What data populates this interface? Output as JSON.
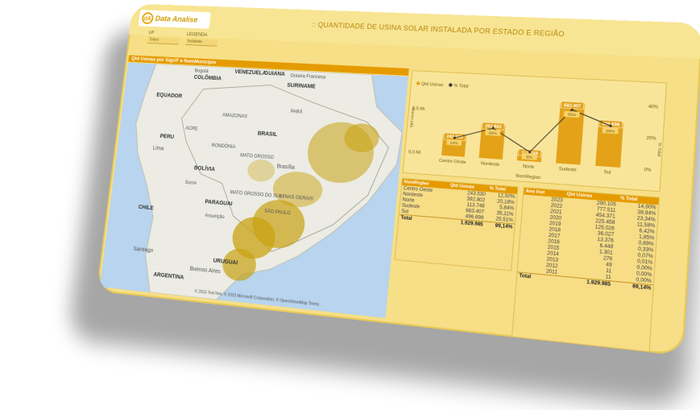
{
  "header": {
    "logo_mark": "dA",
    "logo_text": "Data Analise",
    "title": ":: QUANTIDADE DE USINA SOLAR INSTALADA POR ESTADO E REGIÃO"
  },
  "filters": [
    {
      "label": "UF",
      "value": "Todos"
    },
    {
      "label": "LEGENDA",
      "value": "Instalada"
    }
  ],
  "map": {
    "title": "Qtd Usinas por SigUF e NomMunicipio",
    "countries": [
      "BRASIL",
      "BOLÍVIA",
      "PARAGUAI",
      "CHILE",
      "ARGENTINA",
      "URUGUAI",
      "PERU",
      "COLÔMBIA",
      "EQUADOR",
      "VENEZUELA",
      "GUIANA",
      "SURINAME"
    ],
    "cities": [
      "Bogotá",
      "Lima",
      "Brasília",
      "Santiago",
      "Buenos Aires",
      "Sucre",
      "Assunção",
      "Guiana Francesa"
    ],
    "states": [
      "AMAZONAS",
      "RONDÔNIA",
      "MATO GROSSO",
      "MATO GROSSO DO SUL",
      "MINAS GERAIS",
      "SÃO PAULO",
      "ACRE",
      "PARÁ"
    ],
    "attribution": "© 2023 TomTom, © 2023 Microsoft Corporation, © OpenStreetMap  Terms"
  },
  "chart_data": {
    "type": "bar",
    "title": "Qtd Usinas e % Total por NomRegiao",
    "legend": [
      "Qtd Usinas",
      "% Total"
    ],
    "colors": {
      "bar": "#e3a218",
      "line": "#3c3a2a",
      "label_bg": "#f7d26a"
    },
    "xlabel": "NomRegiao",
    "ylabel_left": "Qtd Usinas",
    "ylabel_right": "% Total",
    "yticks_left": [
      "0,5 Mi",
      "0,0 Mi"
    ],
    "yticks_right": [
      "40%",
      "20%",
      "0%"
    ],
    "categories": [
      "Centro Oeste",
      "Nordeste",
      "Norte",
      "Sudeste",
      "Sul"
    ],
    "series": [
      {
        "name": "Qtd Usinas",
        "values": [
          243530,
          392802,
          113748,
          683407,
          496698
        ],
        "labels": [
          "243.530",
          "392.802",
          "113.748",
          "683.407",
          "496.698"
        ]
      },
      {
        "name": "% Total",
        "values": [
          12,
          20,
          6,
          35,
          26
        ],
        "labels": [
          "12%",
          "20%",
          "6%",
          "35%",
          "26%"
        ]
      }
    ]
  },
  "region_table": {
    "headers": [
      "NomRegiao",
      "Qtd Usinas",
      "% Total"
    ],
    "rows": [
      [
        "Centro Oeste",
        "243.530",
        "12,50%"
      ],
      [
        "Nordeste",
        "392.802",
        "20,18%"
      ],
      [
        "Norte",
        "113.748",
        "5,84%"
      ],
      [
        "Sudeste",
        "683.407",
        "35,11%"
      ],
      [
        "Sul",
        "496.698",
        "25,51%"
      ]
    ],
    "total": [
      "Total",
      "1.929.985",
      "99,14%"
    ]
  },
  "year_table": {
    "headers": [
      "Ano Inst",
      "Qtd Usinas",
      "% Total"
    ],
    "rows": [
      [
        "2023",
        "290.105",
        "14,90%"
      ],
      [
        "2022",
        "777.511",
        "39,94%"
      ],
      [
        "2021",
        "454.371",
        "23,34%"
      ],
      [
        "2020",
        "225.458",
        "11,58%"
      ],
      [
        "2019",
        "125.026",
        "6,42%"
      ],
      [
        "2018",
        "36.027",
        "1,85%"
      ],
      [
        "2017",
        "13.376",
        "0,69%"
      ],
      [
        "2016",
        "6.448",
        "0,33%"
      ],
      [
        "2015",
        "1.301",
        "0,07%"
      ],
      [
        "2014",
        "276",
        "0,01%"
      ],
      [
        "2013",
        "49",
        "0,00%"
      ],
      [
        "2012",
        "11",
        "0,00%"
      ],
      [
        "2011",
        "11",
        "0,00%"
      ]
    ],
    "total": [
      "Total",
      "1.929.985",
      "99,14%"
    ]
  }
}
